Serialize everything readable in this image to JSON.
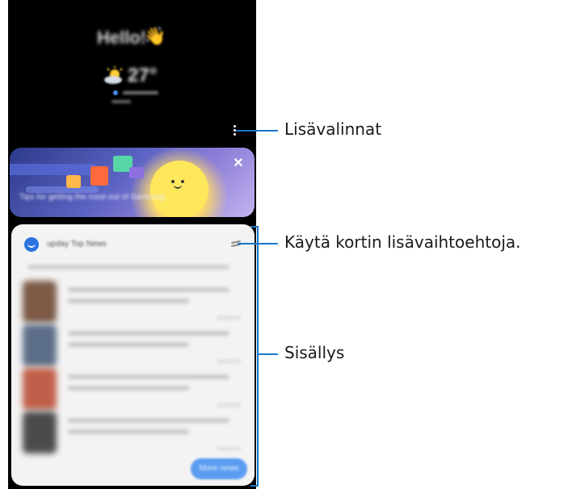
{
  "weather_widget": {
    "greeting": "Hello!",
    "temperature": "27°"
  },
  "tips_banner": {
    "text": "Tips for getting the most out of Samsung",
    "close_label": "✕"
  },
  "news_card": {
    "source_title": "upday Top News",
    "more_button_label": "More news",
    "thumbnail_colors": [
      "#7c5a46",
      "#5d6e88",
      "#c0604a",
      "#4b4b4b"
    ]
  },
  "callouts": {
    "more_options": "Lisävalinnat",
    "card_options": "Käytä kortin lisävaihtoehtoja.",
    "content": "Sisällys"
  },
  "colors": {
    "callout_blue": "#1677c9",
    "phone_background": "#000000"
  }
}
